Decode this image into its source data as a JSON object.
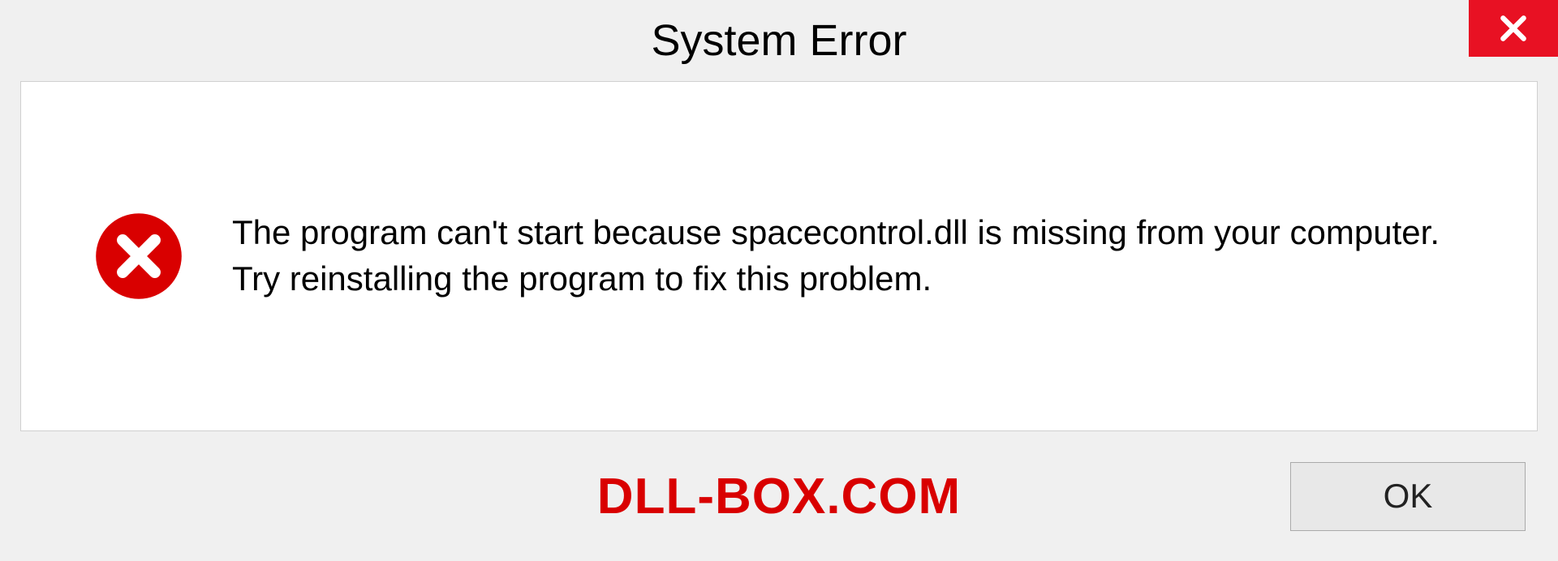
{
  "dialog": {
    "title": "System Error",
    "message": "The program can't start because spacecontrol.dll is missing from your computer. Try reinstalling the program to fix this problem.",
    "ok_label": "OK"
  },
  "watermark": "DLL-BOX.COM",
  "colors": {
    "close_bg": "#e81123",
    "error_icon": "#d90000",
    "watermark": "#d90000"
  }
}
